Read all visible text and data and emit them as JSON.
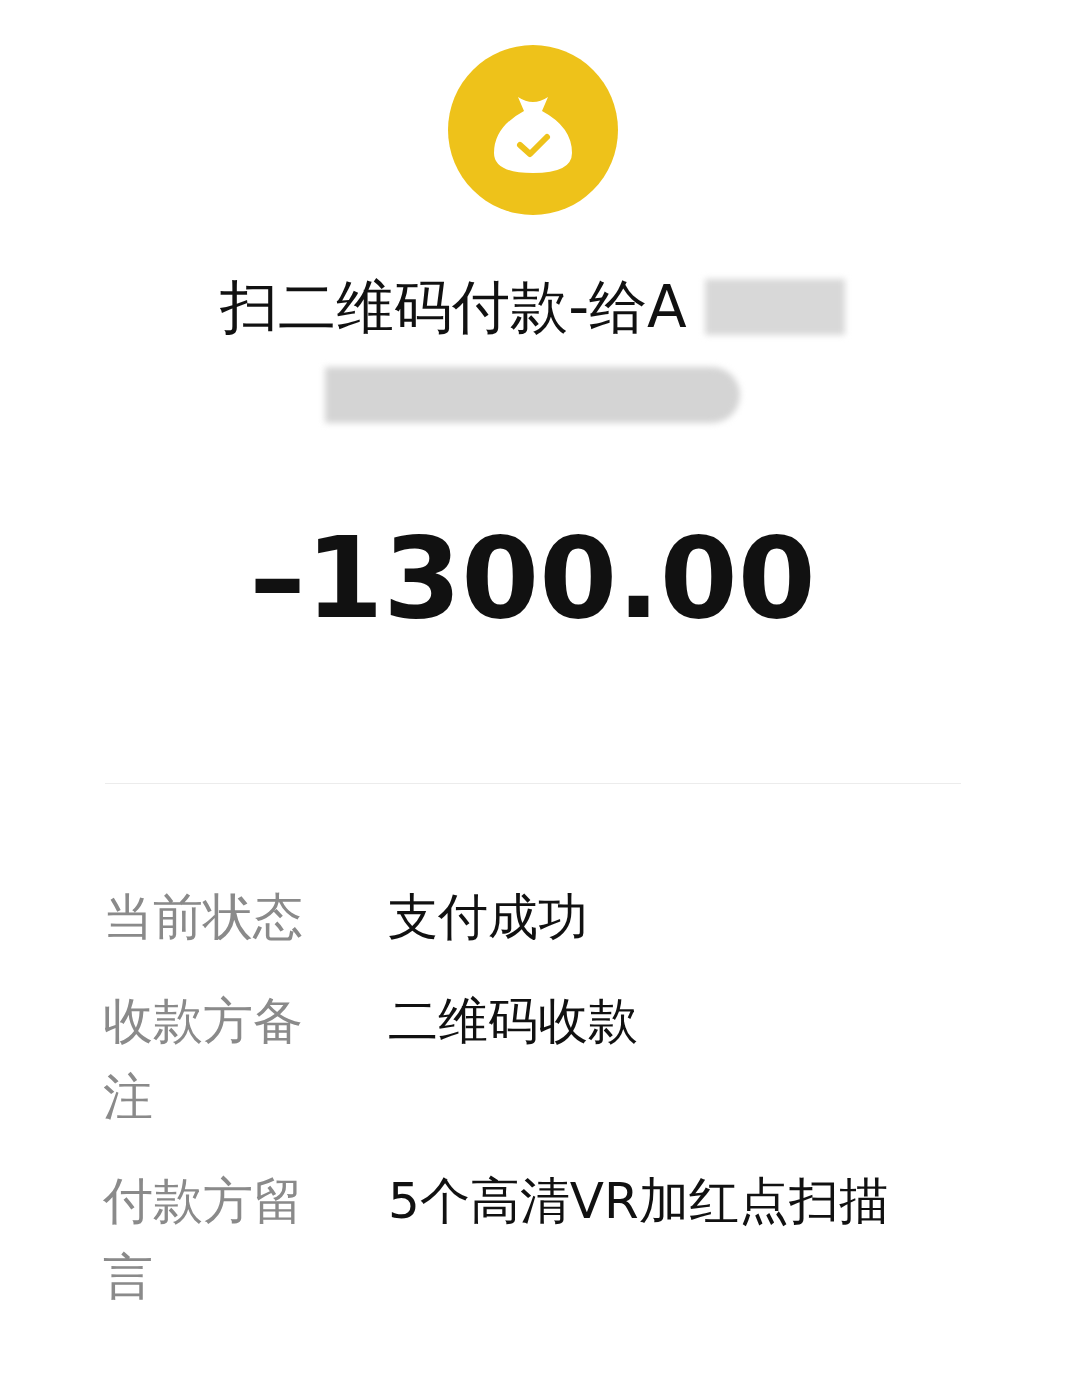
{
  "header": {
    "title": "扫二维码付款-给A"
  },
  "amount": "–1300.00",
  "details": [
    {
      "label": "当前状态",
      "value": "支付成功"
    },
    {
      "label": "收款方备注",
      "value": "二维码收款"
    },
    {
      "label": "付款方留言",
      "value": "5个高清VR加红点扫描"
    }
  ]
}
